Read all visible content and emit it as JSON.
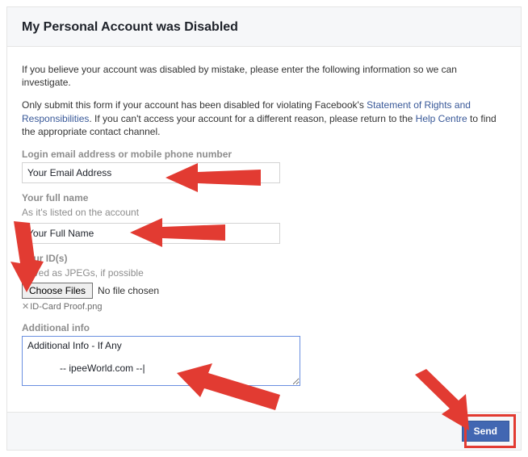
{
  "header": {
    "title": "My Personal Account was Disabled"
  },
  "intro": {
    "p1": "If you believe your account was disabled by mistake, please enter the following information so we can investigate.",
    "p2a": "Only submit this form if your account has been disabled for violating Facebook's ",
    "link1": "Statement of Rights and Responsibilities",
    "p2b": ". If you can't access your account for a different reason, please return to the ",
    "link2": "Help Centre",
    "p2c": " to find the appropriate contact channel."
  },
  "fields": {
    "login": {
      "label": "Login email address or mobile phone number",
      "value": "Your Email Address"
    },
    "name": {
      "label": "Your full name",
      "sub": "As it's listed on the account",
      "value": "Your Full Name"
    },
    "ids": {
      "label": "Your ID(s)",
      "sub": "Saved as JPEGs, if possible",
      "button": "Choose Files",
      "status": "No file chosen",
      "chosen": "ID-Card Proof.png"
    },
    "additional": {
      "label": "Additional info",
      "value": "Additional Info - If Any\n\n            -- ipeeWorld.com --|"
    }
  },
  "footer": {
    "send": "Send"
  }
}
